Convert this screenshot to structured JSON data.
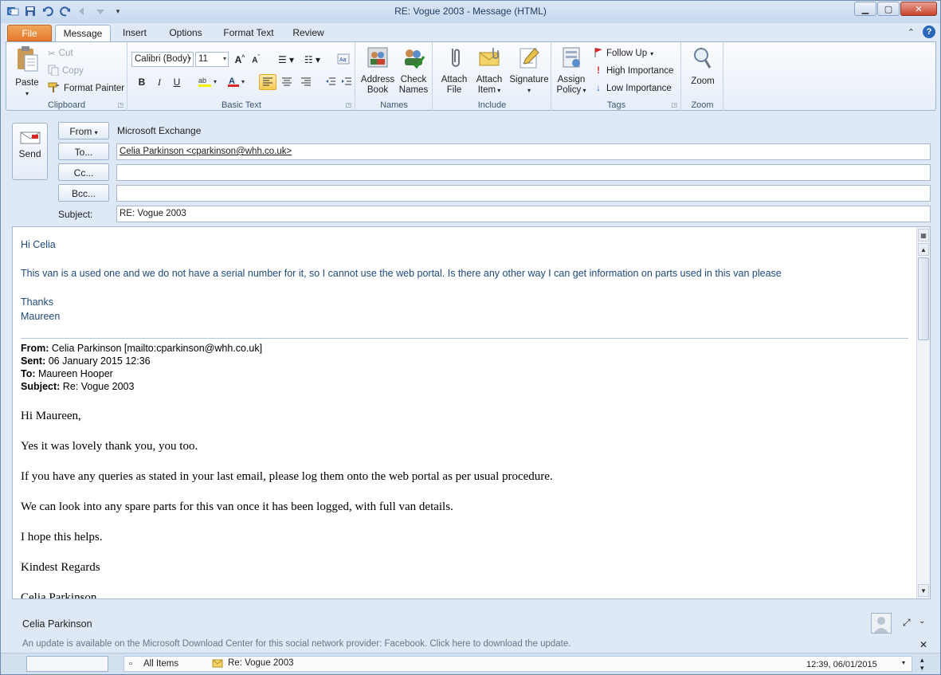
{
  "window": {
    "title": "RE: Vogue 2003  -  Message (HTML)"
  },
  "tabs": [
    {
      "label": "File"
    },
    {
      "label": "Message"
    },
    {
      "label": "Insert"
    },
    {
      "label": "Options"
    },
    {
      "label": "Format Text"
    },
    {
      "label": "Review"
    }
  ],
  "ribbon": {
    "clipboard": {
      "label": "Clipboard",
      "paste": "Paste",
      "cut": "Cut",
      "copy": "Copy",
      "format_painter": "Format Painter"
    },
    "basic_text": {
      "label": "Basic Text",
      "font": "Calibri (Body)",
      "size": "11",
      "bold": "B",
      "italic": "I",
      "underline": "U"
    },
    "names": {
      "label": "Names",
      "address_book_1": "Address",
      "address_book_2": "Book",
      "check_names_1": "Check",
      "check_names_2": "Names"
    },
    "include": {
      "label": "Include",
      "attach_file_1": "Attach",
      "attach_file_2": "File",
      "attach_item_1": "Attach",
      "attach_item_2": "Item",
      "signature": "Signature"
    },
    "tags": {
      "label": "Tags",
      "assign_policy_1": "Assign",
      "assign_policy_2": "Policy",
      "follow_up": "Follow Up",
      "high_importance": "High Importance",
      "low_importance": "Low Importance"
    },
    "zoom": {
      "label": "Zoom",
      "zoom": "Zoom"
    }
  },
  "header": {
    "send": "Send",
    "from_button": "From",
    "from_value": "Microsoft Exchange",
    "to_button": "To...",
    "to_value": "Celia Parkinson <cparkinson@whh.co.uk>",
    "cc_button": "Cc...",
    "cc_value": "",
    "bcc_button": "Bcc...",
    "bcc_value": "",
    "subject_label": "Subject:",
    "subject_value": "RE: Vogue 2003"
  },
  "body": {
    "reply": {
      "greeting": "Hi Celia",
      "text": "This van is a used one and we do not have a serial number for it, so I cannot use the web portal.  Is there any other way I can get information on parts used in this van please",
      "thanks": "Thanks",
      "signature": "Maureen"
    },
    "quoted_header": {
      "from_label": "From:",
      "from": "Celia Parkinson [mailto:cparkinson@whh.co.uk]",
      "sent_label": "Sent:",
      "sent": "06 January 2015 12:36",
      "to_label": "To:",
      "to": "Maureen Hooper",
      "subject_label": "Subject:",
      "subject": "Re: Vogue 2003"
    },
    "original": [
      "Hi Maureen,",
      "Yes it was lovely thank you, you too.",
      "If you have any queries as stated in your last email, please log them onto the web portal as per usual procedure.",
      "We can look into any spare parts for this van once it has been logged, with full van details.",
      "I hope this helps.",
      "Kindest Regards",
      "Celia Parkinson"
    ]
  },
  "people_pane": {
    "name": "Celia Parkinson",
    "notice": "An update is available on the Microsoft Download Center for this social network provider: Facebook. Click here to download the update."
  },
  "status": {
    "folder": "All Items",
    "item": "Re: Vogue 2003",
    "time": "12:39, 06/01/2015"
  }
}
